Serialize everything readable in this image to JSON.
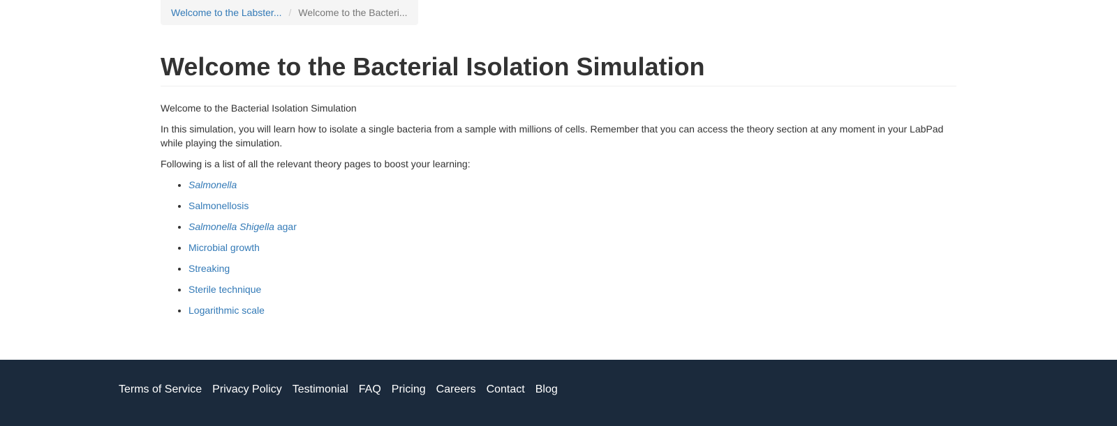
{
  "breadcrumb": {
    "items": [
      {
        "label": "Welcome to the Labster..."
      },
      {
        "label": "Welcome to the Bacteri..."
      }
    ],
    "separator": "/"
  },
  "page": {
    "title": "Welcome to the Bacterial Isolation Simulation",
    "intro": "Welcome to the Bacterial Isolation Simulation",
    "description": "In this simulation, you will learn how to isolate a single bacteria from a sample with millions of cells. Remember that you can access the theory section at any moment in your LabPad while playing the simulation.",
    "list_intro": "Following is a list of all the relevant theory pages to boost your learning:",
    "theory_links": [
      {
        "italic": "Salmonella",
        "text": ""
      },
      {
        "italic": "",
        "text": "Salmonellosis"
      },
      {
        "italic": "Salmonella Shigella",
        "text": " agar"
      },
      {
        "italic": "",
        "text": "Microbial growth"
      },
      {
        "italic": "",
        "text": "Streaking"
      },
      {
        "italic": "",
        "text": "Sterile technique"
      },
      {
        "italic": "",
        "text": "Logarithmic scale"
      }
    ]
  },
  "footer": {
    "links": [
      {
        "label": "Terms of Service"
      },
      {
        "label": "Privacy Policy"
      },
      {
        "label": "Testimonial"
      },
      {
        "label": "FAQ"
      },
      {
        "label": "Pricing"
      },
      {
        "label": "Careers"
      },
      {
        "label": "Contact"
      },
      {
        "label": "Blog"
      }
    ]
  },
  "colors": {
    "link": "#337ab7",
    "footer_bg": "#1b2a3c",
    "breadcrumb_bg": "#f5f5f5",
    "text": "#333333"
  }
}
